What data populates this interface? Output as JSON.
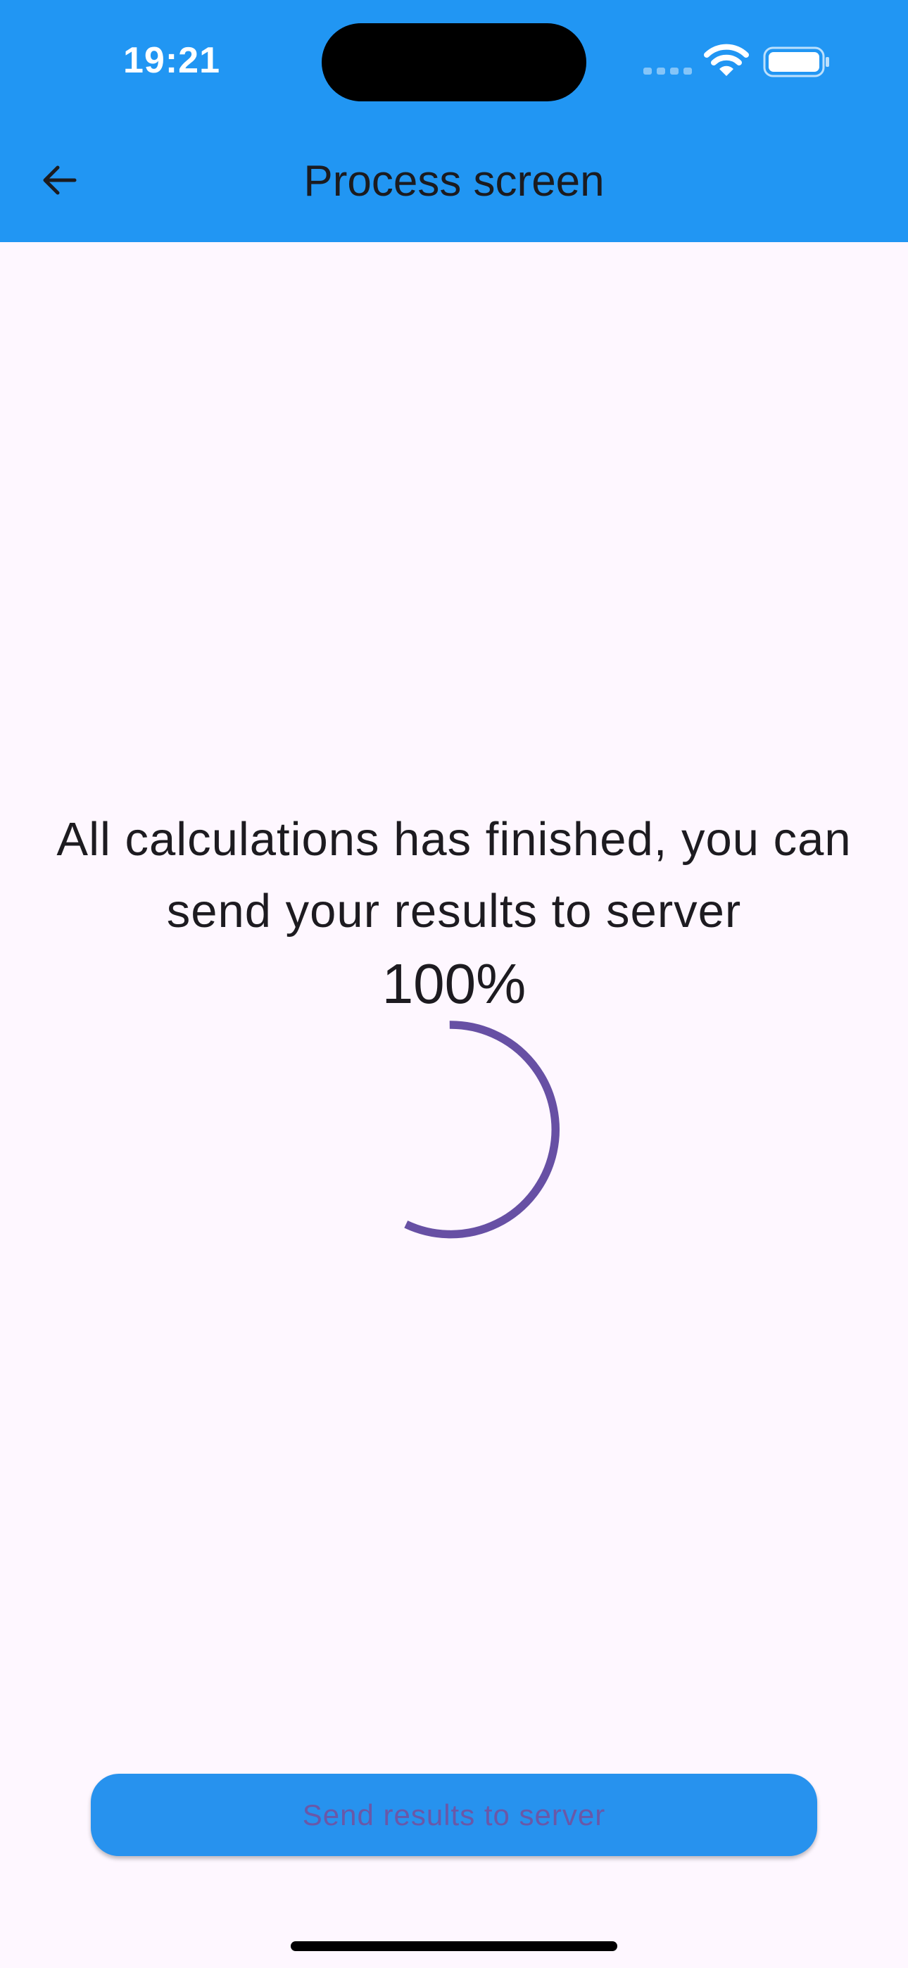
{
  "status_bar": {
    "time": "19:21",
    "icons": [
      "signal-icon",
      "wifi-icon",
      "battery-icon"
    ]
  },
  "app_bar": {
    "title": "Process screen",
    "back_icon": "arrow-left-icon"
  },
  "main": {
    "message": "All calculations has finished, you can send your results to server",
    "progress_label": "100%",
    "progress_value": 1.0
  },
  "actions": {
    "send_label": "Send results to server"
  },
  "colors": {
    "app_bar": "#2196F3",
    "background": "#FEF7FF",
    "spinner": "#6750A4",
    "button_bg": "#2792EE",
    "button_text": "#6A58A8"
  }
}
